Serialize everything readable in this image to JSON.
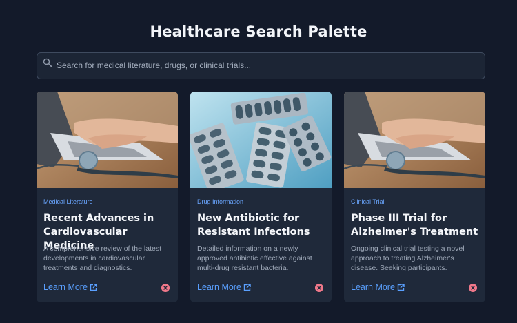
{
  "page": {
    "title": "Healthcare Search Palette"
  },
  "search": {
    "placeholder": "Search for medical literature, drugs, or clinical trials..."
  },
  "cards": [
    {
      "category": "Medical Literature",
      "title": "Recent Advances in Cardiovascular Medicine",
      "description": "A comprehensive review of the latest developments in cardiovascular treatments and diagnostics.",
      "link": "Learn More",
      "image": "laptop-stethoscope-photo"
    },
    {
      "category": "Drug Information",
      "title": "New Antibiotic for Resistant Infections",
      "description": "Detailed information on a newly approved antibiotic effective against multi-drug resistant bacteria.",
      "link": "Learn More",
      "image": "pill-blister-packs-photo"
    },
    {
      "category": "Clinical Trial",
      "title": "Phase III Trial for Alzheimer's Treatment",
      "description": "Ongoing clinical trial testing a novel approach to treating Alzheimer's disease. Seeking participants.",
      "link": "Learn More",
      "image": "laptop-stethoscope-photo"
    }
  ],
  "colors": {
    "background": "#131a2a",
    "card": "#1f293a",
    "accent": "#5aa0ff",
    "remove": "#f0788a"
  }
}
